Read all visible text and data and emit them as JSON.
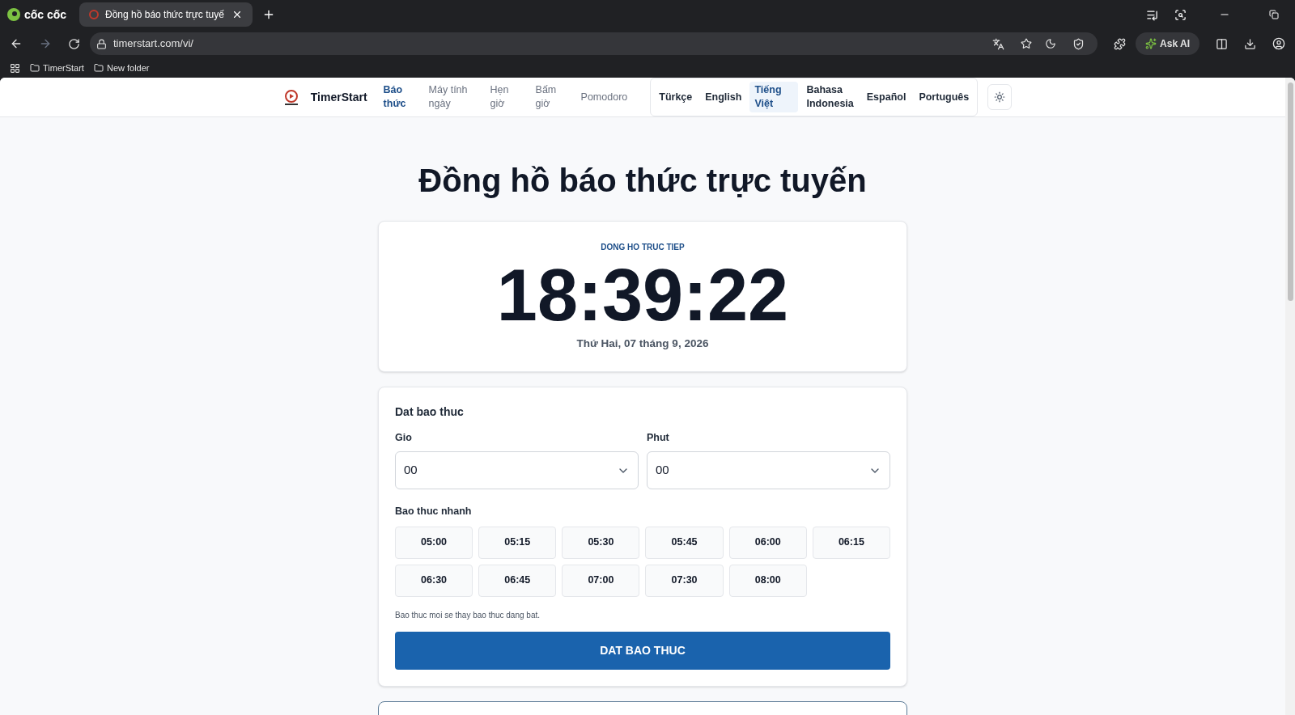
{
  "browser": {
    "brand": "cốc cốc",
    "tab": {
      "title": "Đồng hồ báo thức trực tuyế",
      "selected": true
    },
    "url": "timerstart.com/vi/",
    "ask_ai": "Ask AI",
    "bookmarks": [
      "TimerStart",
      "New folder"
    ]
  },
  "site": {
    "logo": "TimerStart",
    "nav": [
      {
        "label": "Báo thức",
        "selected": true
      },
      {
        "label": "Máy tính ngày",
        "selected": false
      },
      {
        "label": "Hẹn giờ",
        "selected": false
      },
      {
        "label": "Bấm giờ",
        "selected": false
      },
      {
        "label": "Pomodoro",
        "selected": false
      }
    ],
    "languages": [
      {
        "label": "Türkçe",
        "selected": false
      },
      {
        "label": "English",
        "selected": false
      },
      {
        "label": "Tiếng Việt",
        "selected": true
      },
      {
        "label": "Bahasa Indonesia",
        "selected": false
      },
      {
        "label": "Español",
        "selected": false
      },
      {
        "label": "Português",
        "selected": false
      }
    ]
  },
  "heading": "Đồng hồ báo thức trực tuyến",
  "clock": {
    "label": "DONG HO TRUC TIEP",
    "time": "18:39:22",
    "date": "Thứ Hai, 07 tháng 9, 2026"
  },
  "alarm_form": {
    "title": "Dat bao thuc",
    "fields": [
      {
        "label": "Gio",
        "value": "00"
      },
      {
        "label": "Phut",
        "value": "00"
      }
    ],
    "quick_label": "Bao thuc nhanh",
    "quick": [
      "05:00",
      "05:15",
      "05:30",
      "05:45",
      "06:00",
      "06:15",
      "06:30",
      "06:45",
      "07:00",
      "07:30",
      "08:00"
    ],
    "note": "Bao thuc moi se thay bao thuc dang bat.",
    "submit": "DAT BAO THUC"
  }
}
